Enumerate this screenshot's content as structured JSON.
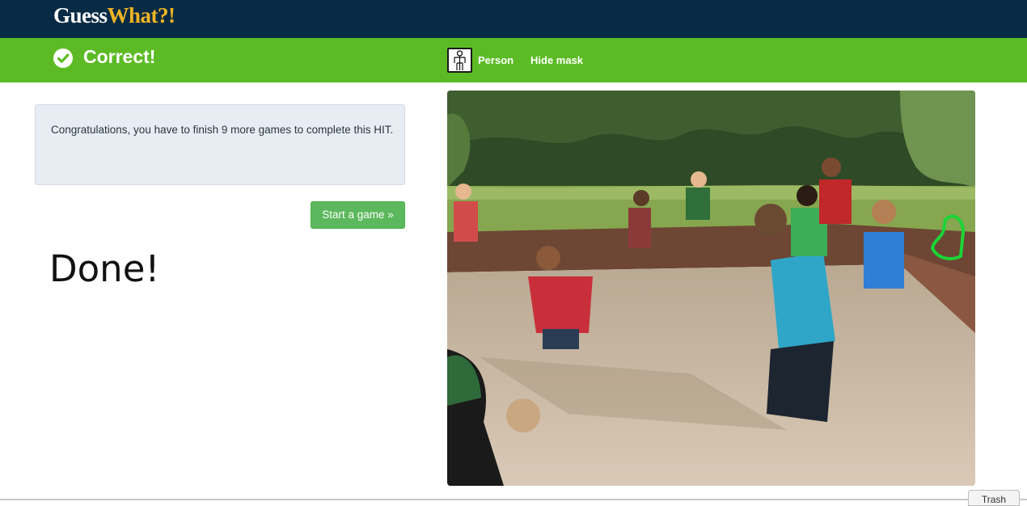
{
  "header": {
    "brand_part1": "Guess",
    "brand_part2": "What?!"
  },
  "status": {
    "icon": "check-circle-icon",
    "text": "Correct!",
    "category_icon": "person-icon",
    "category_label": "Person",
    "hide_mask_label": "Hide mask"
  },
  "main": {
    "message": "Congratulations, you have to finish 9 more games to complete this HIT.",
    "start_button": "Start a game »",
    "done_text": "Done!"
  },
  "footer": {
    "trash_label": "Trash"
  },
  "colors": {
    "topbar": "#082b45",
    "brand_accent": "#f0b323",
    "status_green": "#5cbb25",
    "button_green": "#5cb85c",
    "info_bg": "#e8edf4"
  }
}
